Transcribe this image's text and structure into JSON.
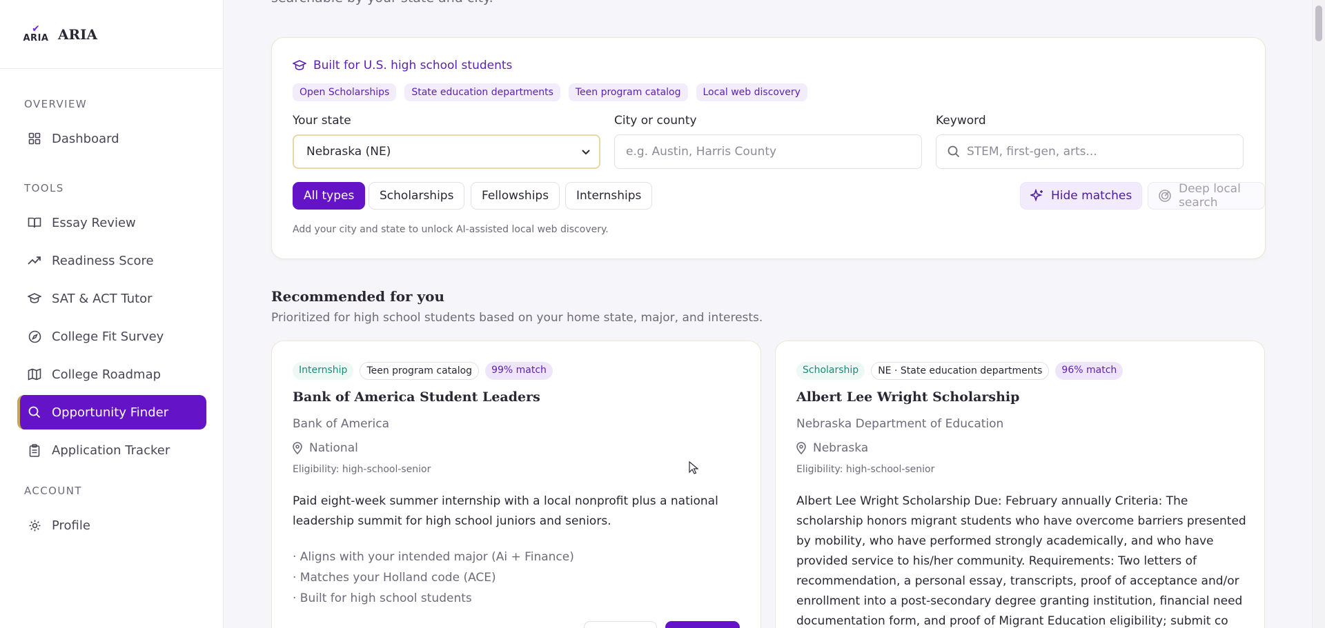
{
  "app": {
    "logo_text": "ARIA",
    "name": "ARIA"
  },
  "sidebar": {
    "sections": {
      "overview": "OVERVIEW",
      "tools": "TOOLS",
      "account": "ACCOUNT"
    },
    "items": [
      {
        "label": "Dashboard",
        "icon": "grid-icon"
      },
      {
        "label": "Essay Review",
        "icon": "book-icon"
      },
      {
        "label": "Readiness Score",
        "icon": "trend-up-icon"
      },
      {
        "label": "SAT & ACT Tutor",
        "icon": "graduation-cap-icon"
      },
      {
        "label": "College Fit Survey",
        "icon": "compass-icon"
      },
      {
        "label": "College Roadmap",
        "icon": "map-icon"
      },
      {
        "label": "Opportunity Finder",
        "icon": "search-icon",
        "active": true
      },
      {
        "label": "Application Tracker",
        "icon": "clipboard-icon"
      },
      {
        "label": "Profile",
        "icon": "gear-icon"
      }
    ]
  },
  "header": {
    "cut_text": "searchable by your state and city."
  },
  "filters": {
    "built_for": "Built for U.S. high school students",
    "tags": [
      "Open Scholarships",
      "State education departments",
      "Teen program catalog",
      "Local web discovery"
    ],
    "state_label": "Your state",
    "state_value": "Nebraska (NE)",
    "city_label": "City or county",
    "city_placeholder": "e.g. Austin, Harris County",
    "keyword_label": "Keyword",
    "keyword_placeholder": "STEM, first-gen, arts...",
    "types": [
      "All types",
      "Scholarships",
      "Fellowships",
      "Internships"
    ],
    "active_type": "All types",
    "hide_matches": "Hide matches",
    "deep_search": "Deep local search",
    "hint": "Add your city and state to unlock AI-assisted local web discovery."
  },
  "recommended": {
    "title": "Recommended for you",
    "subtitle": "Prioritized for high school students based on your home state, major, and interests.",
    "cards": [
      {
        "type": "Internship",
        "source": "Teen program catalog",
        "match": "99% match",
        "title": "Bank of America Student Leaders",
        "org": "Bank of America",
        "location": "National",
        "eligibility": "Eligibility: high-school-senior",
        "description": "Paid eight-week summer internship with a local nonprofit plus a national leadership summit for high school juniors and seniors.",
        "reasons": [
          "· Aligns with your intended major (Ai + Finance)",
          "· Matches your Holland code (ACE)",
          "· Built for high school students"
        ]
      },
      {
        "type": "Scholarship",
        "source": "NE · State education departments",
        "match": "96% match",
        "title": "Albert Lee Wright Scholarship",
        "org": "Nebraska Department of Education",
        "location": "Nebraska",
        "eligibility": "Eligibility: high-school-senior",
        "description": "Albert Lee Wright Scholarship Due: February annually Criteria: The scholarship honors migrant students who have overcome barriers presented by mobility, who have performed strongly academically, and who have provided service to his/her community. Requirements: Two letters of recommendation, a personal essay, transcripts, proof of acceptance and/or enrollment into a post-secondary degree granting institution, financial need documentation form, and proof of Migrant Education eligibility; submit co Listed by Nebraska Department"
      }
    ]
  },
  "colors": {
    "accent": "#6513c7",
    "gold": "#c8a75a"
  }
}
